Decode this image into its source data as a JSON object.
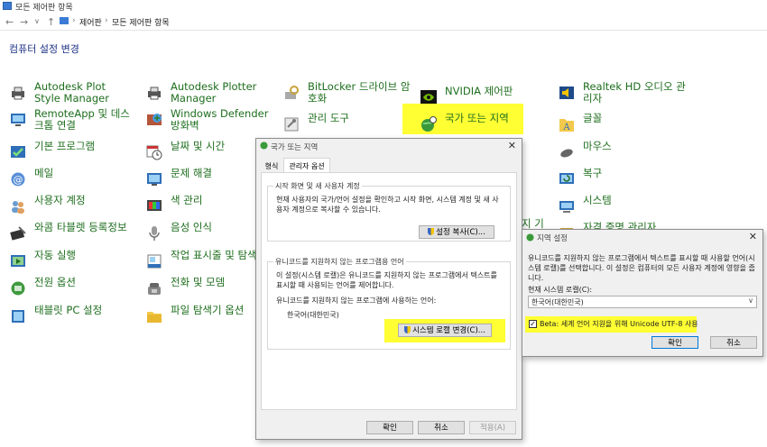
{
  "window": {
    "title": "모든 제어판 항목"
  },
  "address": {
    "crumb1": "제어판",
    "crumb2": "모든 제어판 항목",
    "sep": "›"
  },
  "cp": {
    "heading": "컴퓨터 설정 변경",
    "col1": [
      "Autodesk Plot Style Manager",
      "RemoteApp 및 데스크톱 연결",
      "기본 프로그램",
      "메일",
      "사용자 계정",
      "와콤 타블렛 등록정보",
      "자동 실행",
      "전원 옵션",
      "태블릿 PC 설정"
    ],
    "col2": [
      "Autodesk Plotter Manager",
      "Windows Defender 방화벽",
      "날짜 및 시간",
      "문제 해결",
      "색 관리",
      "음성 인식",
      "작업 표시줄 및 탐색",
      "전화 및 모뎀",
      "파일 탐색기 옵션"
    ],
    "col3": [
      "BitLocker 드라이브 암호화",
      "관리 도구"
    ],
    "col4": [
      "NVIDIA 제어판",
      "국가 또는 지역"
    ],
    "col5": [
      "Realtek HD 오디오 관리자",
      "글꼴",
      "마우스",
      "복구",
      "시스템",
      "자격 증명 관리자"
    ],
    "partial_label": "지 기"
  },
  "region_dialog": {
    "title": "국가 또는 지역",
    "close": "✕",
    "tabs": [
      "형식",
      "관리자 옵션"
    ],
    "group1": {
      "label": "시작 화면 및 새 사용자 계정",
      "text": "현재 사용자의 국가/언어 설정을 확인하고 시작 화면, 시스템 계정 및 새 사용자 계정으로 복사할 수 있습니다.",
      "button": "설정 복사(C)..."
    },
    "group2": {
      "label": "유니코드를 지원하지 않는 프로그램용 언어",
      "text": "이 설정(시스템 로캘)은 유니코드를 지원하지 않는 프로그램에서 텍스트를 표시할 때 사용되는 언어를 제어합니다.",
      "current_label": "유니코드를 지원하지 않는 프로그램에 사용하는 언어:",
      "current_value": "한국어(대한민국)",
      "button": "시스템 로캘 변경(C)..."
    },
    "buttons": {
      "ok": "확인",
      "cancel": "취소",
      "apply": "적용(A)"
    }
  },
  "locale_dialog": {
    "title": "지역 설정",
    "close": "✕",
    "text": "유니코드를 지원하지 않는 프로그램에서 텍스트를 표시할 때 사용할 언어(시스템 로캘)를 선택합니다. 이 설정은 컴퓨터의 모든 사용자 계정에 영향을 줍니다.",
    "current_label": "현재 시스템 로캘(C):",
    "current_value": "한국어(대한민국)",
    "beta": "Beta: 세계 언어 지원을 위해 Unicode UTF-8 사용",
    "beta_checked": true,
    "buttons": {
      "ok": "확인",
      "cancel": "취소"
    }
  },
  "colors": {
    "link": "#1e6e1e",
    "heading": "#1e3287",
    "highlight": "#ffff33",
    "accent": "#0078d7"
  }
}
